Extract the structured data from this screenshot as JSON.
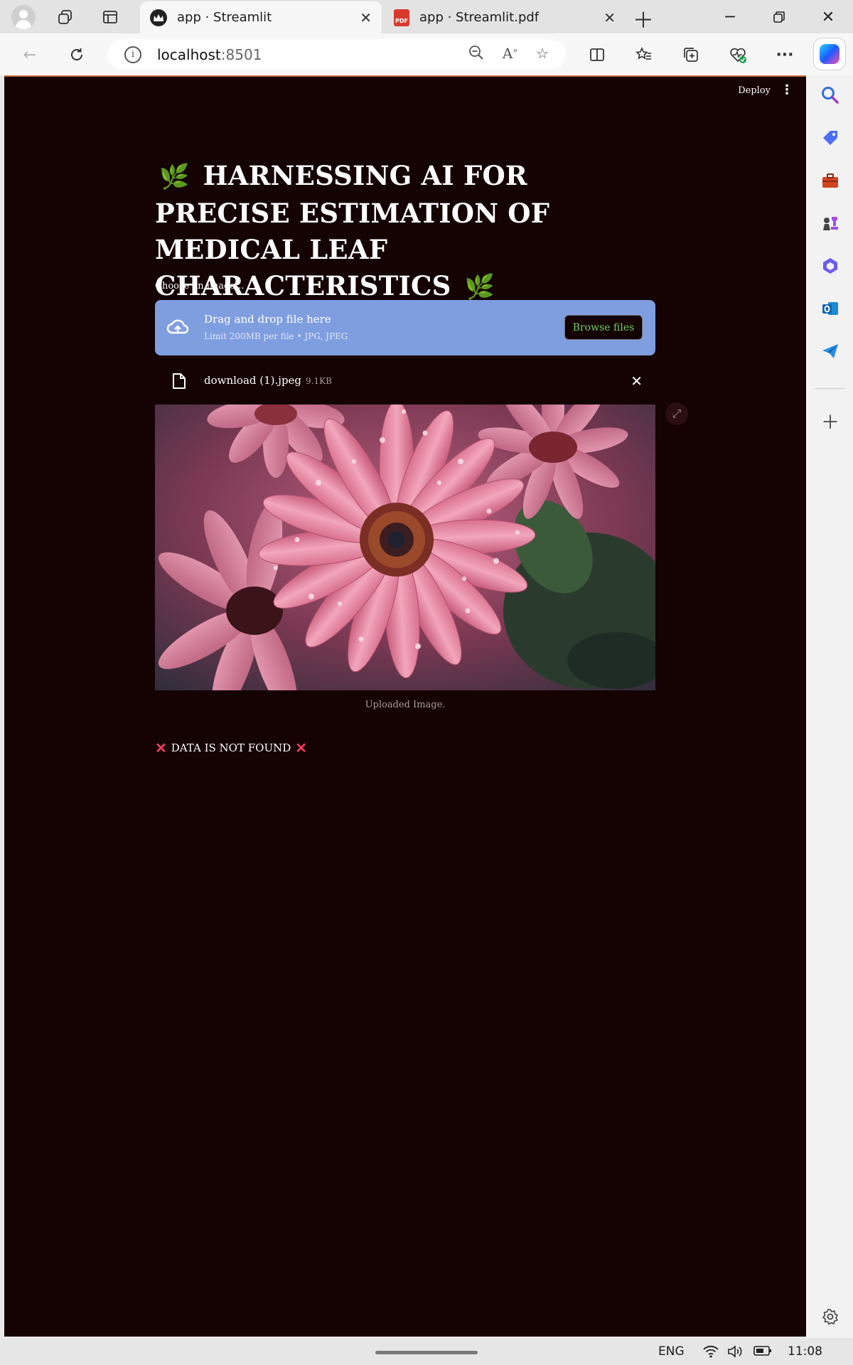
{
  "browser": {
    "tabs": [
      {
        "title": "app · Streamlit",
        "active": true
      },
      {
        "title": "app · Streamlit.pdf",
        "active": false,
        "badge": "PDF"
      }
    ],
    "address": {
      "host": "localhost",
      "port": ":8501"
    }
  },
  "app": {
    "header": {
      "deploy_label": "Deploy"
    },
    "title": {
      "leaf": "🌿",
      "text": "HARNESSING AI FOR PRECISE ESTIMATION OF MEDICAL LEAF CHARACTERISTICS"
    },
    "uploader": {
      "label": "Choose an image...",
      "drop_text": "Drag and drop file here",
      "limit_text": "Limit 200MB per file • JPG, JPEG",
      "browse_label": "Browse files",
      "file": {
        "name": "download (1).jpeg",
        "size": "9.1KB"
      }
    },
    "image": {
      "caption": "Uploaded Image."
    },
    "status": {
      "mark": "✕",
      "text": "DATA IS NOT FOUND"
    }
  },
  "taskbar": {
    "language": "ENG",
    "time": "11:08"
  },
  "colors": {
    "app_background": "#150304",
    "dropzone": "#7f9ee0",
    "browse_text": "#6fcf60",
    "error_mark": "#ee3d5a",
    "leaf": "#79c142"
  }
}
